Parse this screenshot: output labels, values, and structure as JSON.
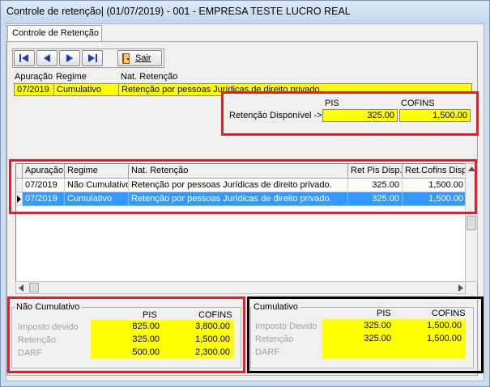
{
  "window": {
    "title": "Controle de retenção| (01/07/2019) - 001 - EMPRESA TESTE LUCRO REAL"
  },
  "tab": {
    "label": "Controle de Retenção"
  },
  "toolbar": {
    "sair_label": "Sair"
  },
  "top_record": {
    "headers": {
      "apuracao": "Apuração",
      "regime": "Regime",
      "nat": "Nat. Retenção"
    },
    "apuracao": "07/2019",
    "regime": "Cumulativo",
    "nat": "Retenção por pessoas Jurídicas de direito privado."
  },
  "disponivel": {
    "label": "Retenção Disponível ->",
    "pis_header": "PIS",
    "cofins_header": "COFINS",
    "pis": "325.00",
    "cofins": "1,500.00"
  },
  "grid": {
    "columns": [
      "Apuração",
      "Regime",
      "Nat. Retenção",
      "Ret Pis Disp.",
      "Ret.Cofins Disp"
    ],
    "rows": [
      {
        "apuracao": "07/2019",
        "regime": "Não Cumulativo",
        "nat": "Retenção por pessoas Jurídicas de direito privado.",
        "pis": "325.00",
        "cofins": "1,500.00",
        "selected": false
      },
      {
        "apuracao": "07/2019",
        "regime": "Cumulativo",
        "nat": "Retenção por pessoas Jurídicas de direito privado.",
        "pis": "325.00",
        "cofins": "1,500.00",
        "selected": true
      }
    ]
  },
  "nao_cumulativo": {
    "title": "Não Cumulativo",
    "pis_header": "PIS",
    "cofins_header": "COFINS",
    "rows": [
      {
        "label": "Imposto devido",
        "pis": "825.00",
        "cofins": "3,800.00"
      },
      {
        "label": "Retenção",
        "pis": "325.00",
        "cofins": "1,500.00"
      },
      {
        "label": "DARF",
        "pis": "500.00",
        "cofins": "2,300.00"
      }
    ]
  },
  "cumulativo": {
    "title": "Cumulativo",
    "pis_header": "PIS",
    "cofins_header": "COFINS",
    "rows": [
      {
        "label": "Imposto Devido",
        "pis": "325.00",
        "cofins": "1,500.00"
      },
      {
        "label": "Retenção",
        "pis": "325.00",
        "cofins": "1,500.00"
      },
      {
        "label": "DARF",
        "pis": "",
        "cofins": ""
      }
    ]
  },
  "colors": {
    "highlight": "#ffff00",
    "annotation_red": "#e0202a",
    "annotation_black": "#000000",
    "selection": "#3399ff"
  }
}
